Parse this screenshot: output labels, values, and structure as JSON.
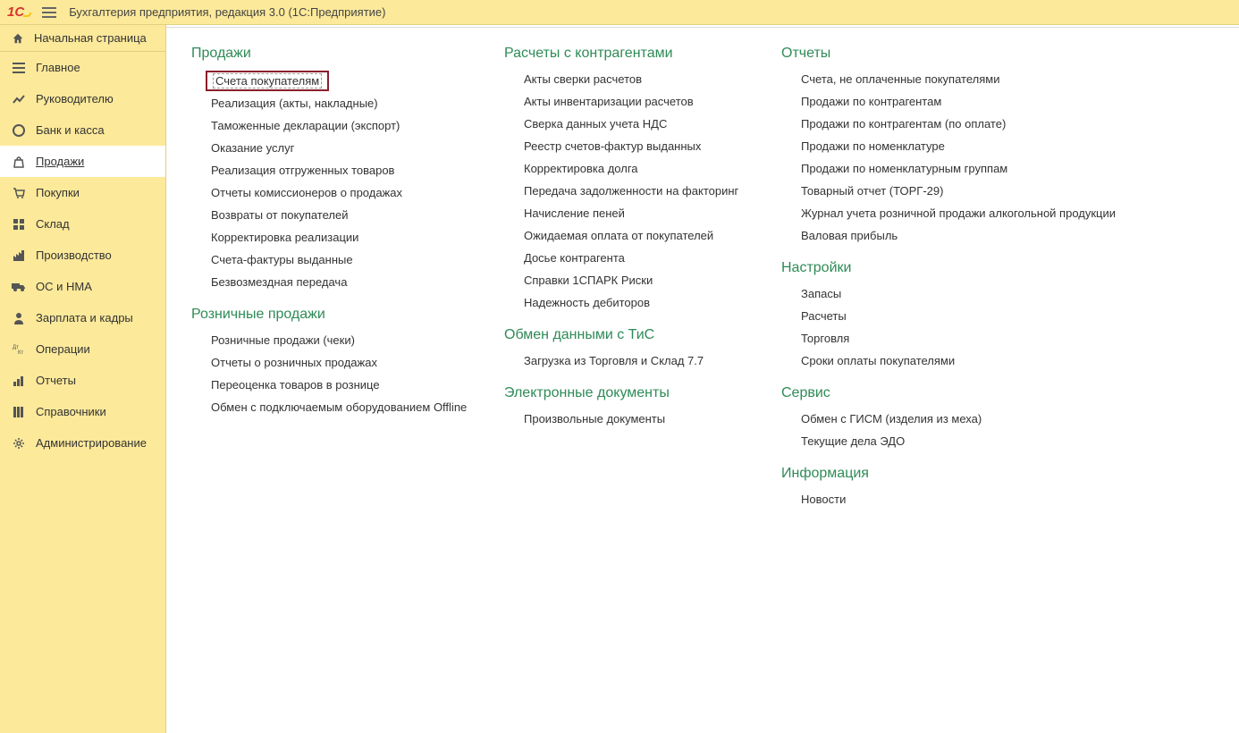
{
  "app": {
    "title": "Бухгалтерия предприятия, редакция 3.0   (1С:Предприятие)"
  },
  "home": {
    "label": "Начальная страница"
  },
  "sidebar": {
    "items": [
      {
        "label": "Главное"
      },
      {
        "label": "Руководителю"
      },
      {
        "label": "Банк и касса"
      },
      {
        "label": "Продажи"
      },
      {
        "label": "Покупки"
      },
      {
        "label": "Склад"
      },
      {
        "label": "Производство"
      },
      {
        "label": "ОС и НМА"
      },
      {
        "label": "Зарплата и кадры"
      },
      {
        "label": "Операции"
      },
      {
        "label": "Отчеты"
      },
      {
        "label": "Справочники"
      },
      {
        "label": "Администрирование"
      }
    ]
  },
  "sections": {
    "sales": {
      "title": "Продажи",
      "items": [
        "Счета покупателям",
        "Реализация (акты, накладные)",
        "Таможенные декларации (экспорт)",
        "Оказание услуг",
        "Реализация отгруженных товаров",
        "Отчеты комиссионеров о продажах",
        "Возвраты от покупателей",
        "Корректировка реализации",
        "Счета-фактуры выданные",
        "Безвозмездная передача"
      ]
    },
    "retail": {
      "title": "Розничные продажи",
      "items": [
        "Розничные продажи (чеки)",
        "Отчеты о розничных продажах",
        "Переоценка товаров в рознице",
        "Обмен с подключаемым оборудованием Offline"
      ]
    },
    "settlements": {
      "title": "Расчеты с контрагентами",
      "items": [
        "Акты сверки расчетов",
        "Акты инвентаризации расчетов",
        "Сверка данных учета НДС",
        "Реестр счетов-фактур выданных",
        "Корректировка долга",
        "Передача задолженности на факторинг",
        "Начисление пеней",
        "Ожидаемая оплата от покупателей",
        "Досье контрагента",
        "Справки 1СПАРК Риски",
        "Надежность дебиторов"
      ]
    },
    "exchange": {
      "title": "Обмен данными с ТиС",
      "items": [
        "Загрузка из Торговля и Склад 7.7"
      ]
    },
    "edocs": {
      "title": "Электронные документы",
      "items": [
        "Произвольные документы"
      ]
    },
    "reports": {
      "title": "Отчеты",
      "items": [
        "Счета, не оплаченные покупателями",
        "Продажи по контрагентам",
        "Продажи по контрагентам (по оплате)",
        "Продажи по номенклатуре",
        "Продажи по номенклатурным группам",
        "Товарный отчет (ТОРГ-29)",
        "Журнал учета розничной продажи алкогольной продукции",
        "Валовая прибыль"
      ]
    },
    "settings": {
      "title": "Настройки",
      "items": [
        "Запасы",
        "Расчеты",
        "Торговля",
        "Сроки оплаты покупателями"
      ]
    },
    "service": {
      "title": "Сервис",
      "items": [
        "Обмен с ГИСМ (изделия из меха)",
        "Текущие дела ЭДО"
      ]
    },
    "info": {
      "title": "Информация",
      "items": [
        "Новости"
      ]
    }
  }
}
